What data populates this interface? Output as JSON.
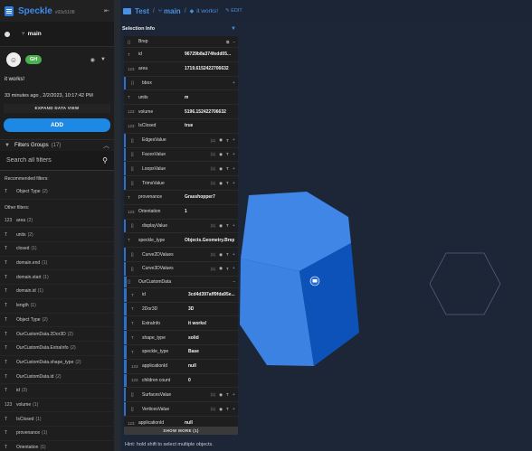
{
  "app": {
    "name": "Speckle",
    "version": "v93c5108",
    "back_icon": "arrow-left-icon"
  },
  "commit": {
    "branch": "main",
    "avatar_initial": "☺",
    "badge": "GH",
    "message": "it works!",
    "date": "33 minutes ago , 2/2/2023, 10:17:42 PM",
    "expand_label": "EXPAND DATA VIEW",
    "add_label": "ADD"
  },
  "filters": {
    "title": "Filters Groups",
    "count": "(17)",
    "search_placeholder": "Search all filters",
    "recommended_label": "Recommended filters:",
    "recommended": [
      {
        "name": "Object Type",
        "count": "(2)"
      }
    ],
    "other_label": "Other filters:",
    "other": [
      {
        "icon": "123",
        "name": "area",
        "count": "(2)"
      },
      {
        "icon": "T",
        "name": "units",
        "count": "(2)"
      },
      {
        "icon": "T",
        "name": "closed",
        "count": "(1)"
      },
      {
        "icon": "T",
        "name": "domain.end",
        "count": "(1)"
      },
      {
        "icon": "T",
        "name": "domain.start",
        "count": "(1)"
      },
      {
        "icon": "T",
        "name": "domain.id",
        "count": "(1)"
      },
      {
        "icon": "T",
        "name": "length",
        "count": "(1)"
      },
      {
        "icon": "T",
        "name": "Object Type",
        "count": "(2)"
      },
      {
        "icon": "T",
        "name": "OurCustomData.2Dor3D",
        "count": "(2)"
      },
      {
        "icon": "T",
        "name": "OurCustomData.ExtraInfo",
        "count": "(2)"
      },
      {
        "icon": "T",
        "name": "OurCustomData.shape_type",
        "count": "(2)"
      },
      {
        "icon": "T",
        "name": "OurCustomData.id",
        "count": "(2)"
      },
      {
        "icon": "T",
        "name": "id",
        "count": "(2)"
      },
      {
        "icon": "123",
        "name": "volume",
        "count": "(1)"
      },
      {
        "icon": "T",
        "name": "IsClosed",
        "count": "(1)"
      },
      {
        "icon": "T",
        "name": "provenance",
        "count": "(1)"
      },
      {
        "icon": "T",
        "name": "Orientation",
        "count": "(1)"
      }
    ]
  },
  "breadcrumb": {
    "stream": "Test",
    "branch": "main",
    "commit": "it works!",
    "edit": "EDIT"
  },
  "selection": {
    "title": "Selection Info",
    "object": {
      "icon": "{}",
      "name": "Brep"
    },
    "rows": [
      {
        "icon": "T",
        "key": "id",
        "value": "96729b8a374fedd05..."
      },
      {
        "icon": "123",
        "key": "area",
        "value": "1719.6152422706632"
      },
      {
        "icon": "{}",
        "key": "bbox",
        "value": "",
        "nested": true
      },
      {
        "icon": "T",
        "key": "units",
        "value": "m"
      },
      {
        "icon": "123",
        "key": "volume",
        "value": "5196.152422706632"
      },
      {
        "icon": "123",
        "key": "IsClosed",
        "value": "true"
      },
      {
        "icon": "[]",
        "key": "EdgesValue",
        "value": "",
        "count": "(1)",
        "nested": true
      },
      {
        "icon": "[]",
        "key": "FacesValue",
        "value": "",
        "count": "(1)",
        "nested": true
      },
      {
        "icon": "[]",
        "key": "LoopsValue",
        "value": "",
        "count": "(1)",
        "nested": true
      },
      {
        "icon": "[]",
        "key": "TrimsValue",
        "value": "",
        "count": "(1)",
        "nested": true
      },
      {
        "icon": "T",
        "key": "provenance",
        "value": "Grasshopper7"
      },
      {
        "icon": "123",
        "key": "Orientation",
        "value": "1"
      },
      {
        "icon": "[]",
        "key": "displayValue",
        "value": "",
        "count": "(1)",
        "nested": true
      },
      {
        "icon": "T",
        "key": "speckle_type",
        "value": "Objects.Geometry.Brep"
      },
      {
        "icon": "[]",
        "key": "Curve2DValues",
        "value": "",
        "count": "(1)",
        "nested": true
      },
      {
        "icon": "[]",
        "key": "Curve3DValues",
        "value": "",
        "count": "(1)",
        "nested": true
      }
    ],
    "custom": {
      "icon": "{}",
      "name": "OurCustomData",
      "rows": [
        {
          "icon": "T",
          "key": "id",
          "value": "3cd4d397aff9fda95e..."
        },
        {
          "icon": "T",
          "key": "2Dor3D",
          "value": "3D"
        },
        {
          "icon": "T",
          "key": "ExtraInfo",
          "value": "it works!"
        },
        {
          "icon": "T",
          "key": "shape_type",
          "value": "solid"
        },
        {
          "icon": "T",
          "key": "speckle_type",
          "value": "Base"
        },
        {
          "icon": "123",
          "key": "applicationId",
          "value": "null"
        },
        {
          "icon": "123",
          "key": "children count",
          "value": "0"
        }
      ]
    },
    "tail_rows": [
      {
        "icon": "[]",
        "key": "SurfacesValue",
        "value": "",
        "count": "(1)",
        "nested": true
      },
      {
        "icon": "[]",
        "key": "VerticesValue",
        "value": "",
        "count": "(1)",
        "nested": true
      },
      {
        "icon": "123",
        "key": "applicationId",
        "value": "null"
      }
    ],
    "show_more": "SHOW MORE (1)"
  },
  "viewer": {
    "hint": "Hint: hold shift to select multiple objects.",
    "colors": {
      "prism_top": "#3f86e6",
      "prism_left": "#3b82e2",
      "prism_right": "#0d52b8",
      "bracket": "#22e322"
    }
  }
}
